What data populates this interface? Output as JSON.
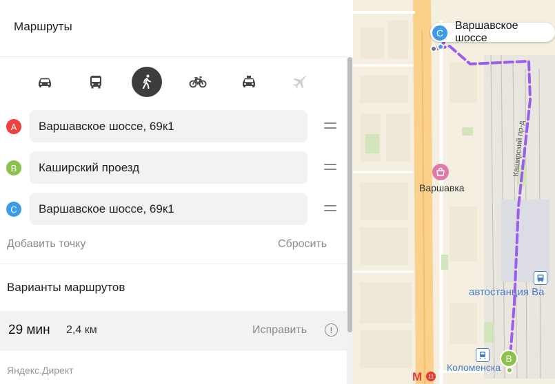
{
  "panel": {
    "title": "Маршруты",
    "transport_modes": [
      {
        "name": "car",
        "icon": "car-icon",
        "active": false
      },
      {
        "name": "bus",
        "icon": "bus-icon",
        "active": false
      },
      {
        "name": "pedestrian",
        "icon": "pedestrian-icon",
        "active": true
      },
      {
        "name": "bicycle",
        "icon": "bicycle-icon",
        "active": false
      },
      {
        "name": "taxi",
        "icon": "taxi-icon",
        "active": false
      },
      {
        "name": "plane",
        "icon": "plane-icon",
        "active": false
      }
    ],
    "waypoints": [
      {
        "marker": "A",
        "value": "Варшавское шоссе, 69к1",
        "color": "#f0413c"
      },
      {
        "marker": "B",
        "value": "Каширский проезд",
        "color": "#8bc34a"
      },
      {
        "marker": "C",
        "value": "Варшавское шоссе, 69к1",
        "color": "#3d9be9"
      }
    ],
    "add_point_label": "Добавить точку",
    "reset_label": "Сбросить",
    "variants_title": "Варианты маршрутов",
    "route": {
      "time": "29 мин",
      "distance": "2,4 км",
      "fix_label": "Исправить",
      "info_icon_glyph": "!"
    },
    "direct_label": "Яндекс.Директ"
  },
  "map": {
    "pin_c_label": "Варшавское шоссе",
    "pin_c_marker": "C",
    "pin_b_marker": "B",
    "street_label": "Каширский пр-д",
    "poi_varshavka": "Варшавка",
    "poi_bus_station": "автостанция Ва",
    "poi_kolomenskaya": "Коломенска",
    "metro_glyph": "М",
    "metro_line": "11",
    "route_color": "#9b5cf0"
  }
}
